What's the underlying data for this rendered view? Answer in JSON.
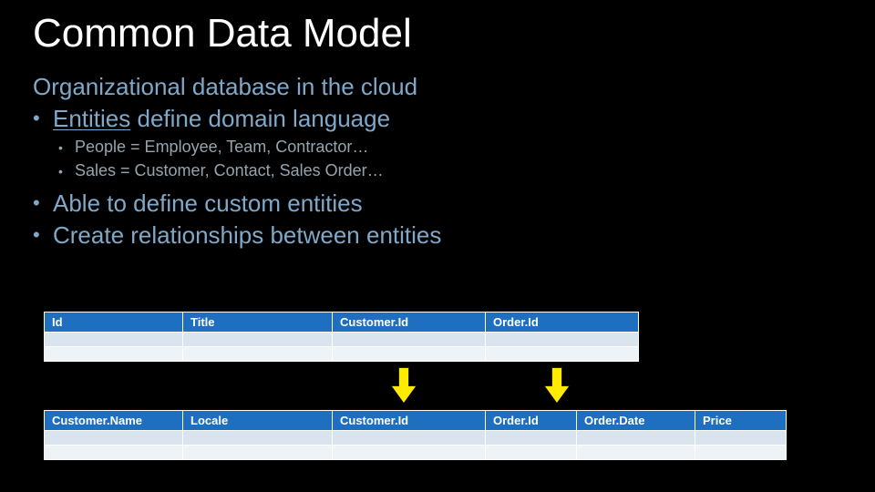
{
  "title": "Common Data Model",
  "lines": {
    "l1": "Organizational database in the cloud",
    "l2_prefix": "Entities",
    "l2_rest": " define domain language",
    "l3": "People = Employee, Team, Contractor…",
    "l4": "Sales = Customer, Contact, Sales Order…",
    "l5": "Able to define custom entities",
    "l6": "Create relationships between entities"
  },
  "table1": {
    "headers": [
      "Id",
      "Title",
      "Customer.Id",
      "Order.Id"
    ]
  },
  "table2": {
    "headers": [
      "Customer.Name",
      "Locale",
      "Customer.Id",
      "Order.Id",
      "Order.Date",
      "Price"
    ]
  },
  "colors": {
    "header_bg": "#1e6fbf",
    "arrow": "#ffeb00"
  }
}
